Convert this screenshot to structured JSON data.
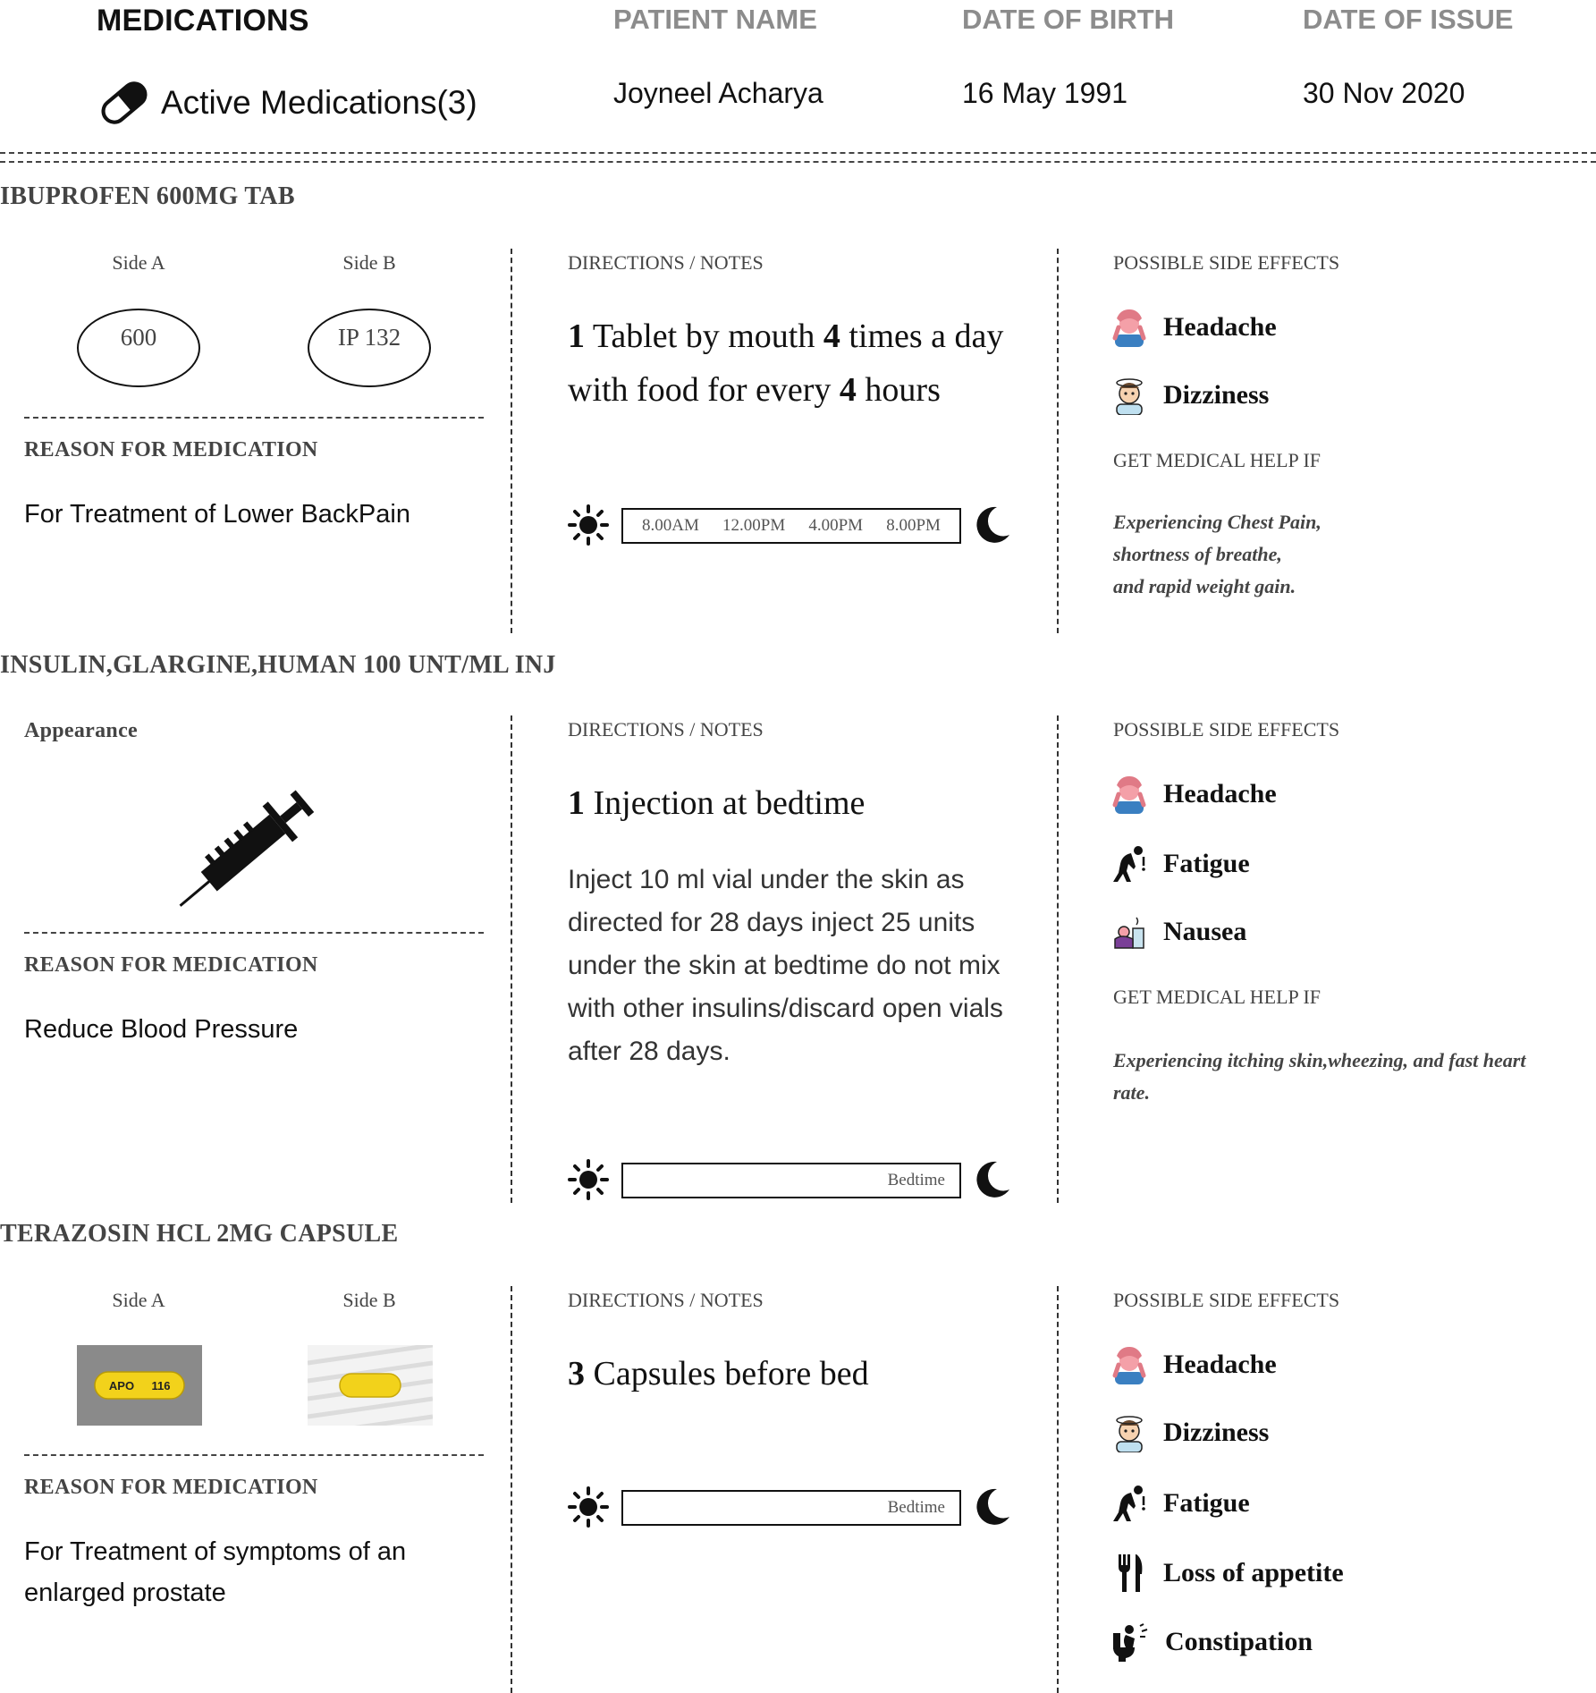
{
  "header": {
    "title": "MEDICATIONS",
    "active_label": "Active Medications(3)",
    "patient_name_label": "PATIENT NAME",
    "patient_name": "Joyneel Acharya",
    "dob_label": "DATE OF BIRTH",
    "dob": "16 May 1991",
    "issue_label": "DATE OF ISSUE",
    "issue_date": "30 Nov 2020"
  },
  "labels": {
    "side_a": "Side A",
    "side_b": "Side B",
    "appearance": "Appearance",
    "reason": "REASON FOR MEDICATION",
    "directions": "DIRECTIONS / NOTES",
    "side_effects": "POSSIBLE SIDE EFFECTS",
    "help": "GET MEDICAL HELP IF"
  },
  "medications": [
    {
      "name": "IBUPROFEN 600MG TAB",
      "side_a_text": "600",
      "side_b_text": "IP 132",
      "reason": "For Treatment of Lower BackPain",
      "directions": {
        "qty": "1",
        "part1": " Tablet by mouth ",
        "times": "4",
        "part2": " times a day with food for every ",
        "hours": "4",
        "part3": " hours"
      },
      "schedule": [
        "8.00AM",
        "12.00PM",
        "4.00PM",
        "8.00PM"
      ],
      "side_effects": [
        {
          "label": "Headache",
          "icon": "headache-icon"
        },
        {
          "label": "Dizziness",
          "icon": "dizziness-icon"
        }
      ],
      "help_lines": [
        "Experiencing Chest Pain,",
        "shortness of breathe,",
        "and rapid weight gain."
      ]
    },
    {
      "name": "INSULIN,GLARGINE,HUMAN 100 UNT/ML INJ",
      "reason": "Reduce Blood Pressure",
      "directions": {
        "qty": "1",
        "text": " Injection at bedtime",
        "notes": "Inject 10 ml vial under the skin as directed for 28 days inject 25 units under the skin at bedtime do not mix with other insulins/discard open vials after 28 days."
      },
      "schedule": [
        "Bedtime"
      ],
      "side_effects": [
        {
          "label": "Headache",
          "icon": "headache-icon"
        },
        {
          "label": "Fatigue",
          "icon": "fatigue-icon"
        },
        {
          "label": "Nausea",
          "icon": "nausea-icon"
        }
      ],
      "help_lines": [
        "Experiencing itching skin,wheezing, and fast heart",
        "rate."
      ]
    },
    {
      "name": "TERAZOSIN HCL 2MG CAPSULE",
      "capsule_imprint_a": "APO",
      "capsule_imprint_b": "116",
      "reason_lines": [
        "For Treatment of symptoms of an",
        "enlarged prostate"
      ],
      "directions": {
        "qty": "3",
        "text": " Capsules before bed"
      },
      "schedule": [
        "Bedtime"
      ],
      "side_effects": [
        {
          "label": "Headache",
          "icon": "headache-icon"
        },
        {
          "label": "Dizziness",
          "icon": "dizziness-icon"
        },
        {
          "label": "Fatigue",
          "icon": "fatigue-icon"
        },
        {
          "label": "Loss of appetite",
          "icon": "fork-knife-icon"
        },
        {
          "label": "Constipation",
          "icon": "constipation-icon"
        }
      ]
    }
  ],
  "colors": {
    "header_label": "#8c8c8c",
    "capsule_yellow": "#f2d21b",
    "capsule_bg": "#8a8a8a",
    "headache_pink": "#f4a0a8"
  }
}
